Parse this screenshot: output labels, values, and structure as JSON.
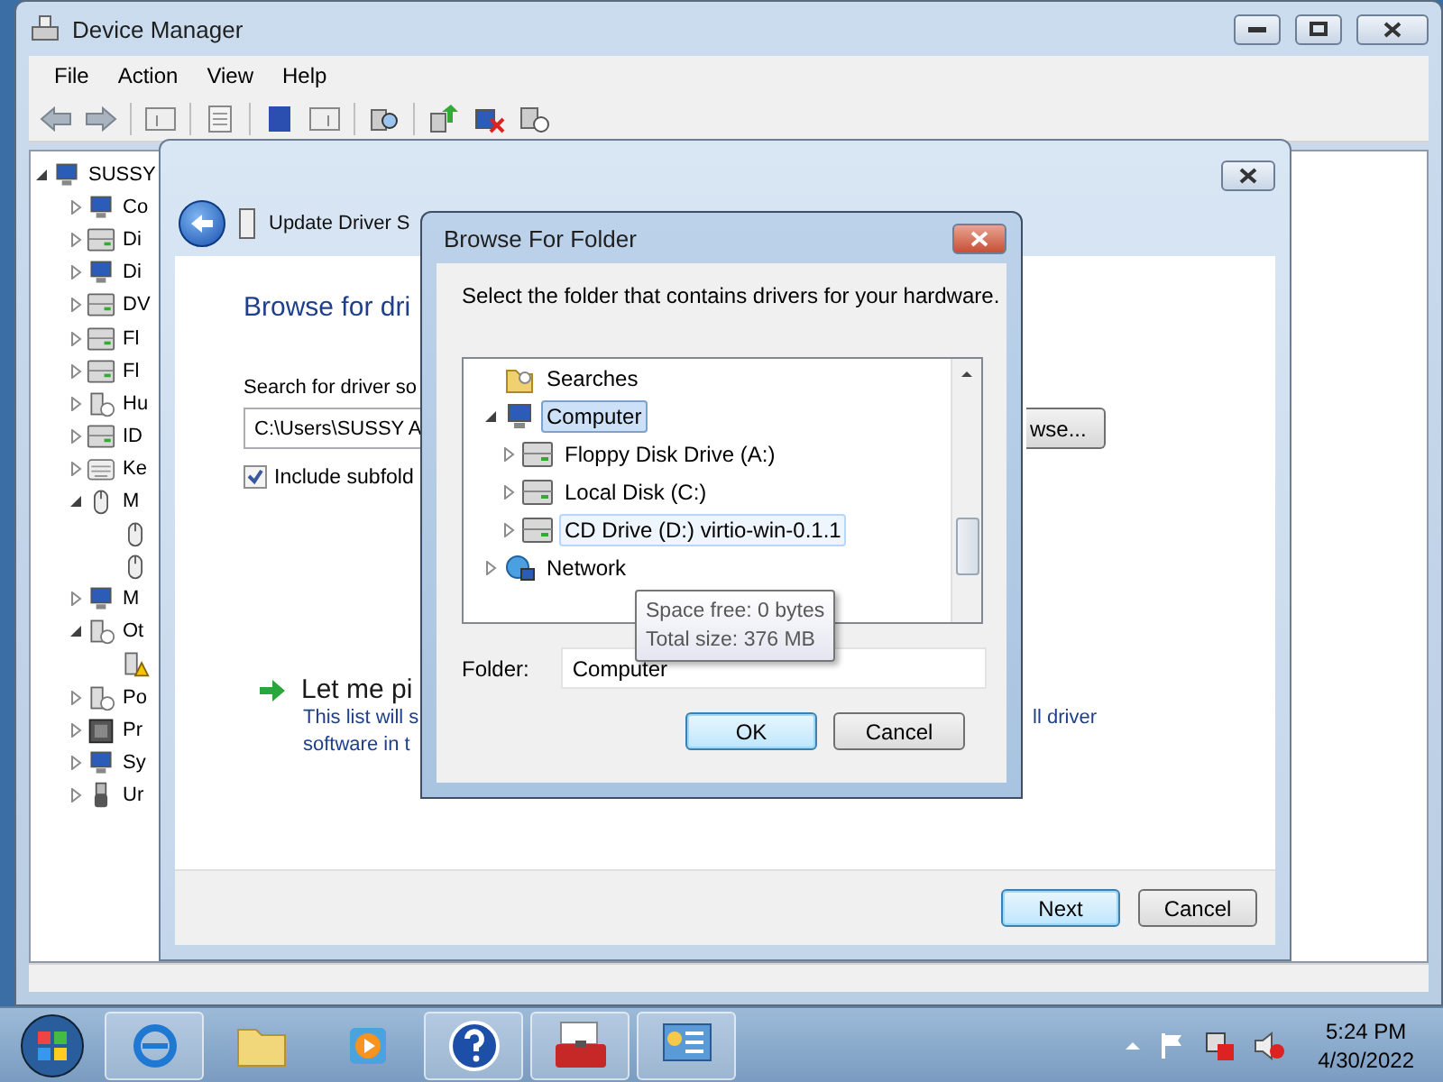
{
  "device_manager": {
    "title": "Device Manager",
    "menu": [
      "File",
      "Action",
      "View",
      "Help"
    ],
    "tree": [
      {
        "label": "SUSSY",
        "kind": "computer",
        "expanded": true,
        "children": [
          {
            "label": "Co",
            "kind": "monitor",
            "expanded": false
          },
          {
            "label": "Di",
            "kind": "drive",
            "expanded": false
          },
          {
            "label": "Di",
            "kind": "monitor",
            "expanded": false
          },
          {
            "label": "DV",
            "kind": "drive",
            "expanded": false
          },
          {
            "label": "Fl",
            "kind": "drive",
            "expanded": false
          },
          {
            "label": "Fl",
            "kind": "drive",
            "expanded": false
          },
          {
            "label": "Hu",
            "kind": "device",
            "expanded": false
          },
          {
            "label": "ID",
            "kind": "drive",
            "expanded": false
          },
          {
            "label": "Ke",
            "kind": "keyboard",
            "expanded": false
          },
          {
            "label": "M",
            "kind": "mouse",
            "expanded": true,
            "children": [
              {
                "kind": "mouse"
              },
              {
                "kind": "mouse"
              }
            ]
          },
          {
            "label": "M",
            "kind": "monitor",
            "expanded": false
          },
          {
            "label": "Ot",
            "kind": "device",
            "expanded": true,
            "children": [
              {
                "kind": "warning"
              }
            ]
          },
          {
            "label": "Po",
            "kind": "device",
            "expanded": false
          },
          {
            "label": "Pr",
            "kind": "chip",
            "expanded": false
          },
          {
            "label": "Sy",
            "kind": "monitor",
            "expanded": false
          },
          {
            "label": "Ur",
            "kind": "plug",
            "expanded": false
          }
        ]
      }
    ]
  },
  "wizard": {
    "title": "Update Driver S",
    "heading": "Browse for dri",
    "search_label": "Search for driver so",
    "path_value": "C:\\Users\\SUSSY A",
    "browse_button": "wse...",
    "include_subfolders": {
      "label": "Include subfold",
      "checked": true
    },
    "pick_link": "Let me pi",
    "description": [
      "This list will s",
      "software in t"
    ],
    "description_tail": "ll driver",
    "buttons": [
      {
        "label": "Next",
        "default": true
      },
      {
        "label": "Cancel",
        "default": false
      }
    ]
  },
  "browse_dialog": {
    "title": "Browse For Folder",
    "instruction": "Select the folder that contains drivers for your hardware.",
    "tree": [
      {
        "label": "Searches",
        "kind": "folder",
        "selected": false,
        "hovered": false
      },
      {
        "label": "Computer",
        "kind": "computer",
        "selected": true,
        "hovered": false,
        "expanded": true,
        "children": [
          {
            "label": "Floppy Disk Drive (A:)",
            "kind": "drive",
            "selected": false,
            "hovered": false,
            "expanded": false
          },
          {
            "label": "Local Disk (C:)",
            "kind": "drive",
            "selected": false,
            "hovered": false,
            "expanded": false
          },
          {
            "label": "CD Drive (D:) virtio-win-0.1.1",
            "kind": "drive",
            "selected": false,
            "hovered": true,
            "expanded": false
          }
        ]
      },
      {
        "label": "Network",
        "kind": "network",
        "selected": false,
        "hovered": false,
        "expanded": false
      }
    ],
    "tooltip": [
      "Space free: 0 bytes",
      "Total size: 376 MB"
    ],
    "folder_label": "Folder:",
    "folder_value": "Computer",
    "buttons": [
      {
        "label": "OK",
        "default": true
      },
      {
        "label": "Cancel",
        "default": false
      }
    ]
  },
  "taskbar": {
    "time": "5:24 PM",
    "date": "4/30/2022"
  }
}
